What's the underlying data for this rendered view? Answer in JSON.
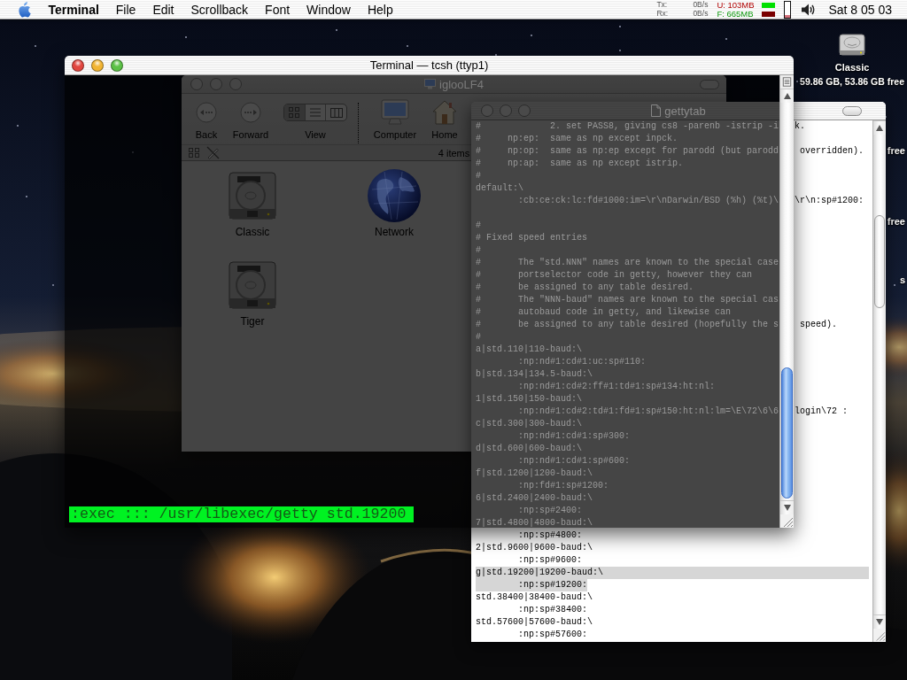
{
  "menubar": {
    "app_name": "Terminal",
    "menus": [
      "File",
      "Edit",
      "Scrollback",
      "Font",
      "Window",
      "Help"
    ],
    "monitor": [
      {
        "label": "Tx:",
        "rate": "0B/s",
        "memory": "U: 103MB",
        "color": "#b00000",
        "bar": {
          "color": "#00e000"
        }
      },
      {
        "label": "Rx:",
        "rate": "0B/s",
        "memory": "F: 665MB",
        "color": "#0f9a0f",
        "bar": {
          "color": "#7a0000"
        }
      }
    ],
    "gauge": {
      "level": 0.15
    },
    "clock": "Sat 8 05 03"
  },
  "desktop": {
    "icons": [
      {
        "name": "Classic",
        "info": "59.86 GB, 53.86 GB free"
      }
    ],
    "covered_labels": [
      "free",
      "free",
      "s"
    ]
  },
  "finder": {
    "title": "iglooLF4",
    "active": false,
    "toolbar": [
      {
        "kind": "back",
        "label": "Back"
      },
      {
        "kind": "forward",
        "label": "Forward"
      },
      {
        "kind": "view",
        "label": "View",
        "modes": [
          {
            "kind": "icon",
            "selected": true
          },
          {
            "kind": "list",
            "selected": false
          },
          {
            "kind": "column",
            "selected": false
          }
        ]
      },
      {
        "kind": "computer",
        "label": "Computer"
      },
      {
        "kind": "home",
        "label": "Home"
      }
    ],
    "item_count": "4 items",
    "items": [
      {
        "kind": "drive",
        "name": "Classic"
      },
      {
        "kind": "network",
        "name": "Network"
      },
      {
        "kind": "drive",
        "name": "Tiger"
      }
    ]
  },
  "gettytab": {
    "title": "gettytab",
    "active": false,
    "lines": [
      {
        "kind": "text",
        "text": "#             2. set PASS8, giving cs8 -parenb -istrip -i",
        "beyond_scrollbar": "k.",
        "dimmed": true,
        "selected": false
      },
      {
        "kind": "text",
        "text": "#     np:ep:  same as np except inpck.",
        "dimmed": true,
        "selected": false
      },
      {
        "kind": "text",
        "text": "#     np:op:  same as np:ep except for parodd (but parodd",
        "beyond_scrollbar": " overridden).",
        "dimmed": true,
        "selected": false
      },
      {
        "kind": "text",
        "text": "#     np:ap:  same as np except istrip.",
        "dimmed": true,
        "selected": false
      },
      {
        "kind": "text",
        "text": "#",
        "dimmed": true,
        "selected": false
      },
      {
        "kind": "text",
        "text": "default:\\",
        "dimmed": true,
        "selected": false
      },
      {
        "kind": "text",
        "text": "        :cb:ce:ck:lc:fd#1000:im=\\r\\nDarwin/BSD (%h) (%t)\\",
        "beyond_scrollbar": "\\r\\n:sp#1200:",
        "dimmed": true,
        "selected": false
      },
      {
        "kind": "blank"
      },
      {
        "kind": "text",
        "text": "#",
        "dimmed": true,
        "selected": false
      },
      {
        "kind": "text",
        "text": "# Fixed speed entries",
        "dimmed": true,
        "selected": false
      },
      {
        "kind": "text",
        "text": "#",
        "dimmed": true,
        "selected": false
      },
      {
        "kind": "text",
        "text": "#       The \"std.NNN\" names are known to the special case",
        "dimmed": true,
        "selected": false
      },
      {
        "kind": "text",
        "text": "#       portselector code in getty, however they can",
        "dimmed": true,
        "selected": false
      },
      {
        "kind": "text",
        "text": "#       be assigned to any table desired.",
        "dimmed": true,
        "selected": false
      },
      {
        "kind": "text",
        "text": "#       The \"NNN-baud\" names are known to the special cas",
        "dimmed": true,
        "selected": false
      },
      {
        "kind": "text",
        "text": "#       autobaud code in getty, and likewise can",
        "dimmed": true,
        "selected": false
      },
      {
        "kind": "text",
        "text": "#       be assigned to any table desired (hopefully the s",
        "beyond_scrollbar": " speed).",
        "dimmed": true,
        "selected": false
      },
      {
        "kind": "text",
        "text": "#",
        "dimmed": true,
        "selected": false
      },
      {
        "kind": "text",
        "text": "a|std.110|110-baud:\\",
        "dimmed": true,
        "selected": false
      },
      {
        "kind": "text",
        "text": "        :np:nd#1:cd#1:uc:sp#110:",
        "dimmed": true,
        "selected": false
      },
      {
        "kind": "text",
        "text": "b|std.134|134.5-baud:\\",
        "dimmed": true,
        "selected": false
      },
      {
        "kind": "text",
        "text": "        :np:nd#1:cd#2:ff#1:td#1:sp#134:ht:nl:",
        "dimmed": true,
        "selected": false
      },
      {
        "kind": "text",
        "text": "1|std.150|150-baud:\\",
        "dimmed": true,
        "selected": false
      },
      {
        "kind": "text",
        "text": "        :np:nd#1:cd#2:td#1:fd#1:sp#150:ht:nl:lm=\\E\\72\\6\\6",
        "beyond_scrollbar": "login\\72 :",
        "dimmed": true,
        "selected": false
      },
      {
        "kind": "text",
        "text": "c|std.300|300-baud:\\",
        "dimmed": true,
        "selected": false
      },
      {
        "kind": "text",
        "text": "        :np:nd#1:cd#1:sp#300:",
        "dimmed": true,
        "selected": false
      },
      {
        "kind": "text",
        "text": "d|std.600|600-baud:\\",
        "dimmed": true,
        "selected": false
      },
      {
        "kind": "text",
        "text": "        :np:nd#1:cd#1:sp#600:",
        "dimmed": true,
        "selected": false
      },
      {
        "kind": "text",
        "text": "f|std.1200|1200-baud:\\",
        "dimmed": true,
        "selected": false
      },
      {
        "kind": "text",
        "text": "        :np:fd#1:sp#1200:",
        "dimmed": true,
        "selected": false
      },
      {
        "kind": "text",
        "text": "6|std.2400|2400-baud:\\",
        "dimmed": true,
        "selected": false
      },
      {
        "kind": "text",
        "text": "        :np:sp#2400:",
        "dimmed": true,
        "selected": false
      },
      {
        "kind": "text",
        "text": "7|std.4800|4800-baud:\\",
        "dimmed": true,
        "selected": false
      },
      {
        "kind": "text",
        "text": "        :np:sp#4800:",
        "dimmed": false,
        "selected": false
      },
      {
        "kind": "text",
        "text": "2|std.9600|9600-baud:\\",
        "dimmed": false,
        "selected": false
      },
      {
        "kind": "text",
        "text": "        :np:sp#9600:",
        "dimmed": false,
        "selected": false
      },
      {
        "kind": "text",
        "text": "g|std.19200|19200-baud:\\",
        "dimmed": false,
        "selected": true
      },
      {
        "kind": "text",
        "text": "        :np:sp#19200:",
        "dimmed": false,
        "selected": true
      },
      {
        "kind": "text",
        "text": "std.38400|38400-baud:\\",
        "dimmed": false,
        "selected": false
      },
      {
        "kind": "text",
        "text": "        :np:sp#38400:",
        "dimmed": false,
        "selected": false
      },
      {
        "kind": "text",
        "text": "std.57600|57600-baud:\\",
        "dimmed": false,
        "selected": false
      },
      {
        "kind": "text",
        "text": "        :np:sp#57600:",
        "dimmed": false,
        "selected": false
      }
    ]
  },
  "terminal": {
    "title": "Terminal — tcsh (ttyp1)",
    "active": true,
    "lines": [
      {
        "text": ":exec ::: /usr/libexec/getty std.19200",
        "selected": true
      }
    ]
  }
}
